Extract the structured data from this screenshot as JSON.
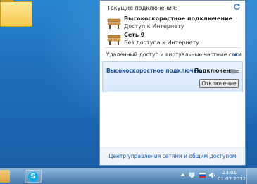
{
  "flyout": {
    "title": "Текущие подключения:",
    "connections": [
      {
        "name": "Высокоскоростное подключение",
        "status": "Доступ к Интернету"
      },
      {
        "name": "Сеть  9",
        "status": "Без доступа к Интернету"
      }
    ],
    "section_label": "Удаленный доступ и виртуальные частные сети",
    "vpn": {
      "name": "Высокоскоростное подключен...",
      "state": "Подключено",
      "disconnect_label": "Отключение"
    },
    "footer_link": "Центр управления сетями и общим доступом"
  },
  "taskbar": {
    "time": "23:01",
    "date": "01.07.2012"
  },
  "colors": {
    "link": "#1c5fb3",
    "vpn_highlight": "#d7e8fa"
  },
  "icons": [
    "folder-icon",
    "refresh-icon",
    "network-bench-icon",
    "chevron-up-icon",
    "plug-icon",
    "skype-icon",
    "flag-icon",
    "network-tray-icon",
    "volume-icon"
  ]
}
